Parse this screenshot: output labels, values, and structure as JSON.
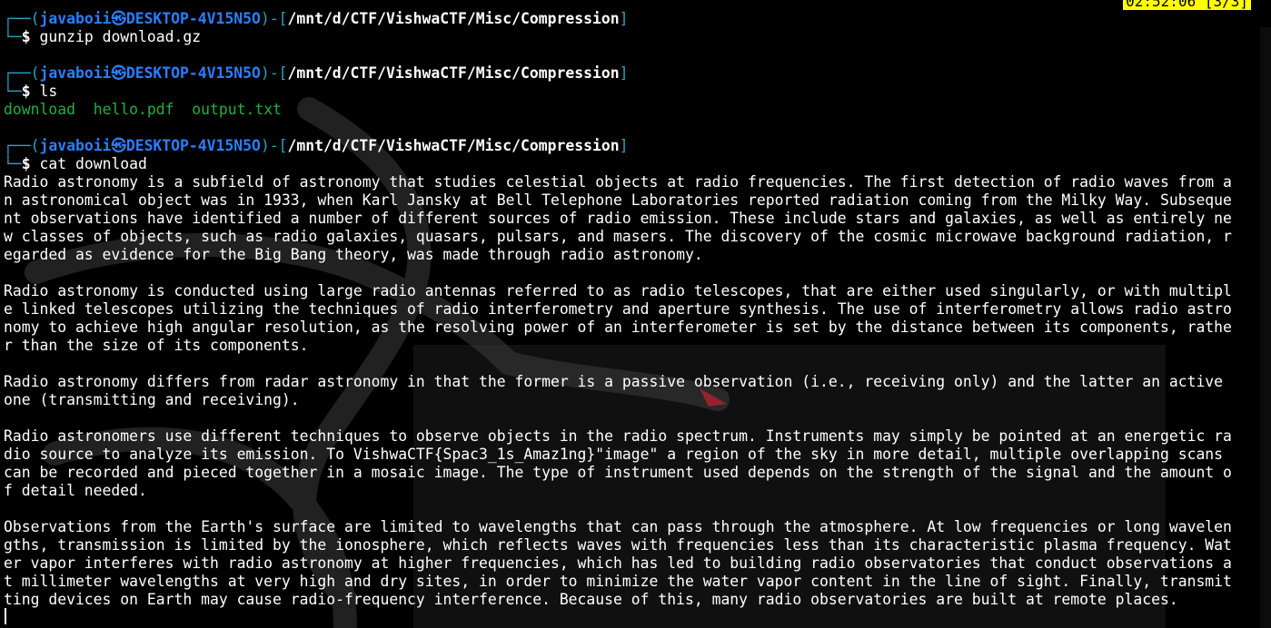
{
  "status_bar": {
    "clock": "02:52:06 [3/3]"
  },
  "prompt": {
    "open": "┌──(",
    "user": "javaboii",
    "at_symbol": "㉿",
    "host": "DESKTOP-4V15N5O",
    "close_mid": ")-[",
    "path": "/mnt/d/CTF/VishwaCTF/Misc/Compression",
    "close": "]",
    "corner": "└─",
    "dollar": "$"
  },
  "commands": [
    {
      "cmd": "gunzip download.gz"
    },
    {
      "cmd": "ls"
    },
    {
      "cmd": "cat download"
    }
  ],
  "ls_output": {
    "files": [
      "download",
      "hello.pdf",
      "output.txt"
    ]
  },
  "cat_output": [
    "Radio astronomy is a subfield of astronomy that studies celestial objects at radio frequencies. The first detection of radio waves from a\nn astronomical object was in 1933, when Karl Jansky at Bell Telephone Laboratories reported radiation coming from the Milky Way. Subseque\nnt observations have identified a number of different sources of radio emission. These include stars and galaxies, as well as entirely ne\nw classes of objects, such as radio galaxies, quasars, pulsars, and masers. The discovery of the cosmic microwave background radiation, r\negarded as evidence for the Big Bang theory, was made through radio astronomy.",
    "Radio astronomy is conducted using large radio antennas referred to as radio telescopes, that are either used singularly, or with multipl\ne linked telescopes utilizing the techniques of radio interferometry and aperture synthesis. The use of interferometry allows radio astro\nnomy to achieve high angular resolution, as the resolving power of an interferometer is set by the distance between its components, rathe\nr than the size of its components.",
    "Radio astronomy differs from radar astronomy in that the former is a passive observation (i.e., receiving only) and the latter an active\none (transmitting and receiving).",
    "Radio astronomers use different techniques to observe objects in the radio spectrum. Instruments may simply be pointed at an energetic ra\ndio source to analyze its emission. To VishwaCTF{Spac3_1s_Amaz1ng}\"image\" a region of the sky in more detail, multiple overlapping scans\ncan be recorded and pieced together in a mosaic image. The type of instrument used depends on the strength of the signal and the amount o\nf detail needed.",
    "Observations from the Earth's surface are limited to wavelengths that can pass through the atmosphere. At low frequencies or long wavelen\ngths, transmission is limited by the ionosphere, which reflects waves with frequencies less than its characteristic plasma frequency. Wat\ner vapor interferes with radio astronomy at higher frequencies, which has led to building radio observatories that conduct observations a\nt millimeter wavelengths at very high and dry sites, in order to minimize the water vapor content in the line of sight. Finally, transmit\nting devices on Earth may cause radio-frequency interference. Because of this, many radio observatories are built at remote places."
  ],
  "colors": {
    "background": "#000000",
    "prompt_frame": "#2aa3c1",
    "prompt_user": "#2a7fff",
    "ls_files": "#20b040",
    "clock_bg": "#ffff00"
  }
}
